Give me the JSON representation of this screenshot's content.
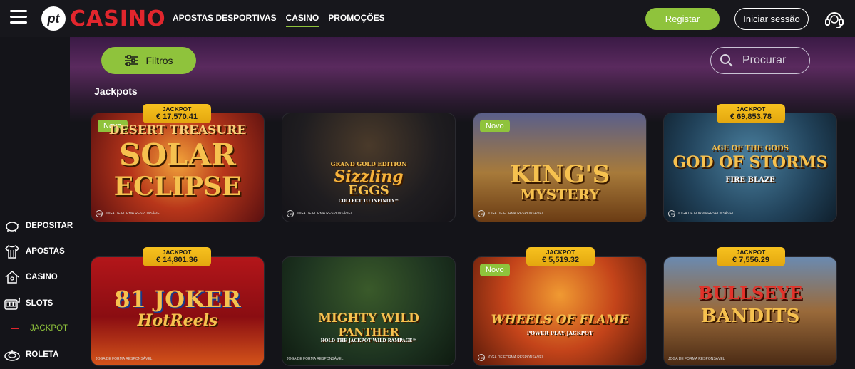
{
  "header": {
    "logo_pt": "pt",
    "logo_text": "CASINO",
    "nav": [
      {
        "label": "APOSTAS DESPORTIVAS",
        "active": false
      },
      {
        "label": "CASINO",
        "active": true
      },
      {
        "label": "PROMOÇÕES",
        "active": false
      }
    ],
    "register_label": "Registar",
    "login_label": "Iniciar sessão"
  },
  "sidebar": {
    "items": [
      {
        "label": "DEPOSITAR",
        "icon": "piggy-bank-icon"
      },
      {
        "label": "APOSTAS",
        "icon": "shirt-icon"
      },
      {
        "label": "CASINO",
        "icon": "house-icon"
      },
      {
        "label": "SLOTS",
        "icon": "slot-machine-icon"
      },
      {
        "label": "JACKPOT",
        "icon": "dash-icon"
      },
      {
        "label": "ROLETA",
        "icon": "roulette-icon"
      }
    ]
  },
  "main": {
    "filter_label": "Filtros",
    "search_placeholder": "Procurar",
    "section_title": "Jackpots",
    "jackpot_label": "JACKPOT",
    "novo_label": "Novo",
    "responsible_text": "JOGA DE FORMA RESPONSÁVEL",
    "age_badge": "+18"
  },
  "games": [
    {
      "name": "Solar Eclipse",
      "title_line1": "DESERT TREASURE",
      "title_line2": "SOLAR",
      "title_line3": "ECLIPSE",
      "jackpot": "€ 17,570.41",
      "novo": true
    },
    {
      "name": "Sizzling Eggs",
      "title_line1": "GRAND GOLD EDITION",
      "title_line2": "Sizzling",
      "title_line3": "EGGS",
      "jackpot": "",
      "novo": false,
      "subtitle": "COLLECT TO INFINITY™"
    },
    {
      "name": "King's Mystery",
      "title_line1": "",
      "title_line2": "KING'S",
      "title_line3": "MYSTERY",
      "jackpot": "",
      "novo": true
    },
    {
      "name": "God of Storms",
      "title_line1": "AGE OF THE GODS",
      "title_line2": "GOD OF STORMS",
      "title_line3": "FIRE BLAZE",
      "jackpot": "€ 69,853.78",
      "novo": false
    },
    {
      "name": "81 Joker Hot Reels",
      "title_line1": "",
      "title_line2": "81 JOKER",
      "title_line3": "HotReels",
      "jackpot": "€ 14,801.36",
      "novo": false
    },
    {
      "name": "Mighty Wild Panther",
      "title_line1": "",
      "title_line2": "MIGHTY WILD",
      "title_line3": "PANTHER",
      "jackpot": "",
      "novo": false,
      "subtitle": "HOLD THE JACKPOT WILD RAMPAGE™"
    },
    {
      "name": "Wheels of Flame",
      "title_line1": "",
      "title_line2": "WHEELS OF FLAME",
      "title_line3": "POWER PLAY JACKPOT",
      "jackpot": "€ 5,519.32",
      "novo": true
    },
    {
      "name": "Bullseye Bandits",
      "title_line1": "",
      "title_line2": "BULLSEYE",
      "title_line3": "BANDITS",
      "jackpot": "€ 7,556.29",
      "novo": false
    }
  ],
  "colors": {
    "accent": "#8fc33c",
    "brand_red": "#e1262d",
    "jackpot_gold": "#f7c21f",
    "background": "#141419"
  }
}
